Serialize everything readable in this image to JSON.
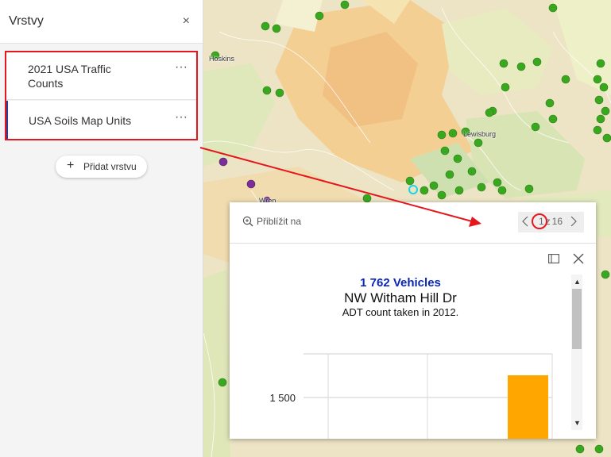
{
  "panel": {
    "title": "Vrstvy",
    "close_icon": "×",
    "layers": [
      {
        "label": "2021 USA Traffic Counts",
        "more": "···"
      },
      {
        "label": "USA Soils Map Units",
        "more": "···"
      }
    ],
    "add_button": {
      "icon": "+",
      "label": "Přidat vrstvu"
    }
  },
  "map": {
    "labels": [
      "Hoskins",
      "Lewisburg",
      "Wren"
    ]
  },
  "popup": {
    "zoom_label": "Přiblížit na",
    "pager": {
      "current": "1",
      "separator": "z",
      "total": "16"
    },
    "value": "1 762 Vehicles",
    "street": "NW Witham Hill Dr",
    "description": "ADT count taken in 2012."
  },
  "chart_data": {
    "type": "bar",
    "categories": [
      ""
    ],
    "values": [
      1762
    ],
    "ytick_labels": [
      "1 500"
    ],
    "bar_color": "#ffa600"
  },
  "colors": {
    "highlight": "#e5161c",
    "value_text": "#0a27b8",
    "selected_accent": "#2b3d94",
    "point_green": "#39a81e",
    "point_purple": "#7b2e98"
  }
}
